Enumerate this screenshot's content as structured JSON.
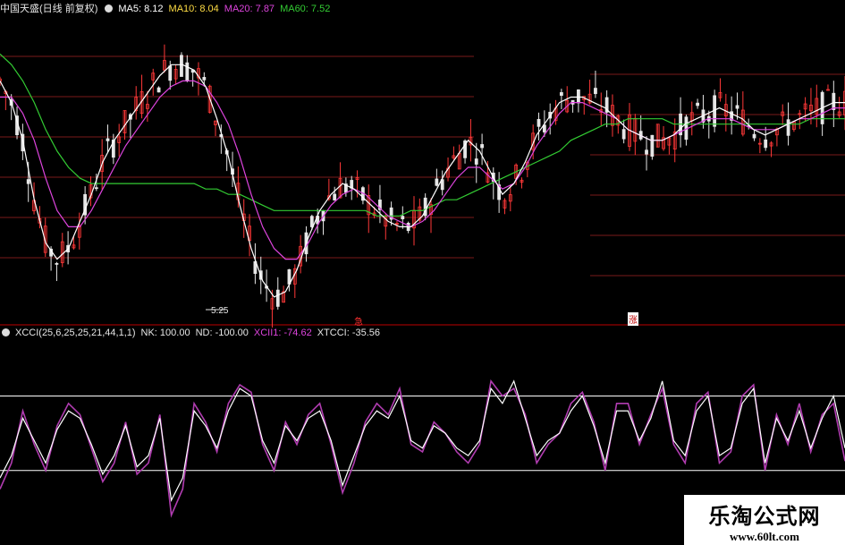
{
  "header": {
    "stock_title": "中国天盛(日线 前复权)",
    "ma5": "MA5: 8.12",
    "ma10": "MA10: 8.04",
    "ma20": "MA20: 7.87",
    "ma60": "MA60: 7.52"
  },
  "indicator": {
    "name": "XCCI(25,6,25,25,21,44,1,1)",
    "nk": "NK: 100.00",
    "nd": "ND: -100.00",
    "xcii": "XCII1: -74.62",
    "xtcci": "XTCCI: -35.56"
  },
  "markers": {
    "left": "急",
    "right": "涨"
  },
  "watermark": {
    "name": "乐淘公式网",
    "url": "www.60lt.com"
  },
  "colors": {
    "background": "#000000",
    "up": "#ff3838",
    "down": "#e6e6e6",
    "ma5": "#ffffff",
    "ma10": "#ffdd44",
    "ma20": "#dd44dd",
    "ma60": "#33cc33",
    "grid": "#7a1a1a",
    "divider": "#bb0000",
    "cci": "#ffffff",
    "xcii": "#b03cb0"
  },
  "chart_data": {
    "type": "line",
    "series": [
      {
        "name": "MA5",
        "values": [
          9.3,
          8.9,
          8.2,
          7.1,
          6.3,
          6.0,
          6.2,
          6.7,
          7.2,
          7.8,
          8.2,
          8.5,
          8.8,
          9.1,
          9.4,
          9.6,
          9.6,
          9.5,
          9.2,
          8.6,
          7.9,
          7.0,
          6.2,
          5.6,
          5.3,
          5.4,
          5.8,
          6.4,
          6.9,
          7.2,
          7.4,
          7.3,
          7.1,
          6.9,
          6.7,
          6.6,
          6.6,
          6.8,
          7.2,
          7.6,
          7.9,
          8.2,
          8.0,
          7.6,
          7.2,
          7.4,
          7.8,
          8.3,
          8.6,
          8.9,
          9.0,
          9.0,
          8.9,
          8.8,
          8.6,
          8.4,
          8.3,
          8.2,
          8.2,
          8.3,
          8.5,
          8.6,
          8.7,
          8.8,
          8.7,
          8.6,
          8.4,
          8.3,
          8.4,
          8.5,
          8.6,
          8.7,
          8.8,
          8.9,
          8.9
        ]
      },
      {
        "name": "MA20",
        "values": [
          9.0,
          9.0,
          8.7,
          8.2,
          7.5,
          6.9,
          6.6,
          6.6,
          6.9,
          7.3,
          7.7,
          8.1,
          8.4,
          8.7,
          9.0,
          9.2,
          9.3,
          9.3,
          9.2,
          8.9,
          8.5,
          7.9,
          7.2,
          6.6,
          6.2,
          6.0,
          6.0,
          6.3,
          6.7,
          7.0,
          7.2,
          7.3,
          7.2,
          7.0,
          6.8,
          6.7,
          6.6,
          6.7,
          6.9,
          7.2,
          7.5,
          7.7,
          7.7,
          7.5,
          7.3,
          7.4,
          7.7,
          8.1,
          8.4,
          8.7,
          8.9,
          8.9,
          8.8,
          8.7,
          8.6,
          8.4,
          8.3,
          8.2,
          8.2,
          8.3,
          8.4,
          8.5,
          8.6,
          8.6,
          8.6,
          8.5,
          8.4,
          8.4,
          8.4,
          8.5,
          8.6,
          8.6,
          8.7,
          8.8,
          8.8
        ]
      },
      {
        "name": "MA60",
        "values": [
          9.8,
          9.6,
          9.3,
          8.9,
          8.4,
          8.0,
          7.7,
          7.5,
          7.4,
          7.4,
          7.4,
          7.4,
          7.4,
          7.4,
          7.4,
          7.4,
          7.4,
          7.4,
          7.3,
          7.3,
          7.2,
          7.2,
          7.1,
          7.0,
          6.9,
          6.9,
          6.9,
          6.9,
          6.9,
          6.9,
          6.9,
          6.9,
          6.9,
          6.8,
          6.8,
          6.8,
          6.9,
          6.9,
          7.0,
          7.1,
          7.1,
          7.2,
          7.3,
          7.4,
          7.5,
          7.6,
          7.7,
          7.8,
          7.9,
          8.0,
          8.2,
          8.3,
          8.4,
          8.5,
          8.5,
          8.6,
          8.6,
          8.6,
          8.6,
          8.5,
          8.5,
          8.5,
          8.5,
          8.5,
          8.5,
          8.5,
          8.5,
          8.5,
          8.5,
          8.5,
          8.5,
          8.6,
          8.6,
          8.6,
          8.6
        ]
      },
      {
        "name": "CCI",
        "values": [
          -120,
          -60,
          40,
          -20,
          -80,
          10,
          60,
          40,
          -30,
          -110,
          -60,
          20,
          -90,
          -60,
          40,
          -180,
          -120,
          60,
          20,
          -40,
          60,
          120,
          100,
          -20,
          -80,
          20,
          -20,
          40,
          60,
          -20,
          -140,
          -60,
          20,
          60,
          40,
          100,
          -20,
          -40,
          20,
          0,
          -40,
          -60,
          -20,
          120,
          80,
          140,
          40,
          -60,
          -20,
          0,
          60,
          100,
          20,
          -80,
          60,
          60,
          -20,
          40,
          140,
          -20,
          -60,
          60,
          100,
          -60,
          -40,
          80,
          120,
          -80,
          40,
          -20,
          60,
          -40,
          40,
          100,
          -40
        ]
      },
      {
        "name": "XCII1",
        "values": [
          -150,
          -80,
          60,
          -30,
          -100,
          20,
          80,
          50,
          -40,
          -130,
          -80,
          30,
          -110,
          -80,
          50,
          -220,
          -150,
          80,
          30,
          -50,
          80,
          130,
          110,
          -30,
          -100,
          30,
          -30,
          50,
          80,
          -30,
          -160,
          -80,
          30,
          80,
          50,
          120,
          -30,
          -50,
          30,
          0,
          -50,
          -80,
          -30,
          140,
          100,
          120,
          50,
          -80,
          -30,
          0,
          80,
          110,
          30,
          -100,
          80,
          80,
          -30,
          50,
          120,
          -30,
          -80,
          80,
          110,
          -80,
          -50,
          100,
          130,
          -100,
          50,
          -30,
          80,
          -50,
          50,
          80,
          -74.62
        ]
      }
    ],
    "ylim_price": [
      5.0,
      10.5
    ],
    "ylim_indicator": [
      -300,
      250
    ],
    "annotations": [
      "5.25"
    ],
    "nk": 100,
    "nd": -100
  }
}
